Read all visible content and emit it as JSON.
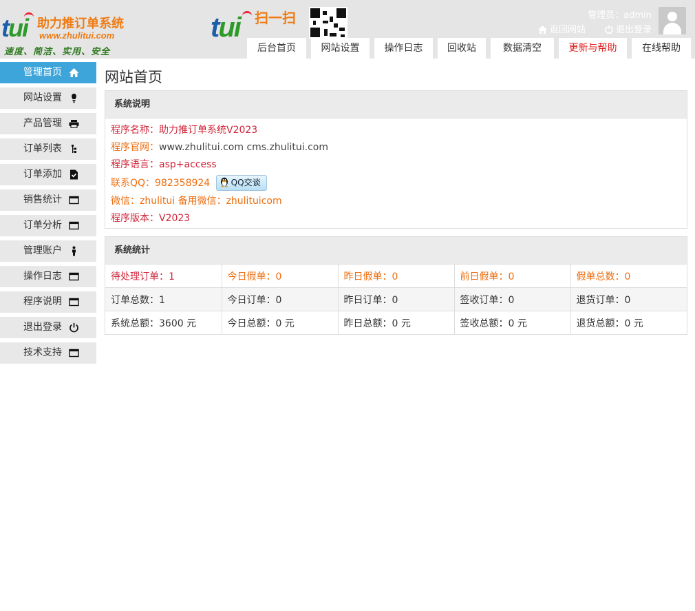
{
  "header": {
    "logo": {
      "mark_t": "t",
      "mark_u": "ui",
      "name": "助力推订单系统",
      "url": "www.zhulitui.com",
      "slogan": "速度、简洁、实用、安全"
    },
    "promo": {
      "mark_t": "t",
      "mark_u": "ui",
      "scan_text": "扫一扫"
    },
    "admin_label": "管理员：admin",
    "links": [
      {
        "label": "返回网站",
        "icon": "home-icon"
      },
      {
        "label": "退出登录",
        "icon": "power-icon"
      }
    ],
    "colors": {
      "header_bg": "#e5e5e5",
      "accent": "#3ea5da",
      "brand_orange": "#ef7b12",
      "brand_blue": "#1c5ea8"
    }
  },
  "topnav": {
    "tabs": [
      {
        "label": "后台首页"
      },
      {
        "label": "网站设置"
      },
      {
        "label": "操作日志"
      },
      {
        "label": "回收站"
      },
      {
        "label": "数据清空"
      },
      {
        "label": "更新与帮助",
        "color": "#e02020"
      },
      {
        "label": "在线帮助"
      }
    ]
  },
  "sidebar": {
    "items": [
      {
        "label": "管理首页",
        "icon": "home-icon",
        "active": true
      },
      {
        "label": "网站设置",
        "icon": "bulb-icon"
      },
      {
        "label": "产品管理",
        "icon": "printer-icon"
      },
      {
        "label": "订单列表",
        "icon": "sitemap-icon"
      },
      {
        "label": "订单添加",
        "icon": "file-check-icon"
      },
      {
        "label": "销售统计",
        "icon": "window-icon"
      },
      {
        "label": "订单分析",
        "icon": "window-icon"
      },
      {
        "label": "管理账户",
        "icon": "person-icon"
      },
      {
        "label": "操作日志",
        "icon": "window-icon"
      },
      {
        "label": "程序说明",
        "icon": "window-icon"
      },
      {
        "label": "退出登录",
        "icon": "power-icon"
      },
      {
        "label": "技术支持",
        "icon": "window-icon"
      }
    ]
  },
  "main": {
    "page_title": "网站首页",
    "system_info": {
      "heading": "系统说明",
      "program_name_label": "程序名称：",
      "program_name_value": "助力推订单系统V2023",
      "site_label": "程序官网：",
      "site_value": "www.zhulitui.com cms.zhulitui.com",
      "lang_label": "程序语言：",
      "lang_value": "asp+access",
      "qq_label": "联系QQ：",
      "qq_value": "982358924",
      "qq_button": "QQ交谈",
      "wechat_label": "微信：",
      "wechat_value": "zhulitui 备用微信：zhulituicom",
      "version_label": "程序版本：",
      "version_value": "V2023"
    },
    "system_stats": {
      "heading": "系统统计",
      "rows": [
        [
          {
            "text": "待处理订单：1",
            "color": "#d0253a"
          },
          {
            "text": "今日假单：0",
            "color": "#ee6d0e"
          },
          {
            "text": "昨日假单：0",
            "color": "#ee6d0e"
          },
          {
            "text": "前日假单：0",
            "color": "#ee6d0e"
          },
          {
            "text": "假单总数：0",
            "color": "#ee6d0e"
          }
        ],
        [
          {
            "text": "订单总数：1"
          },
          {
            "text": "今日订单：0"
          },
          {
            "text": "昨日订单：0"
          },
          {
            "text": "签收订单：0"
          },
          {
            "text": "退货订单：0"
          }
        ],
        [
          {
            "text": "系统总额：3600 元"
          },
          {
            "text": "今日总额：0 元"
          },
          {
            "text": "昨日总额：0 元"
          },
          {
            "text": "签收总额：0 元"
          },
          {
            "text": "退货总额：0 元"
          }
        ]
      ]
    }
  }
}
